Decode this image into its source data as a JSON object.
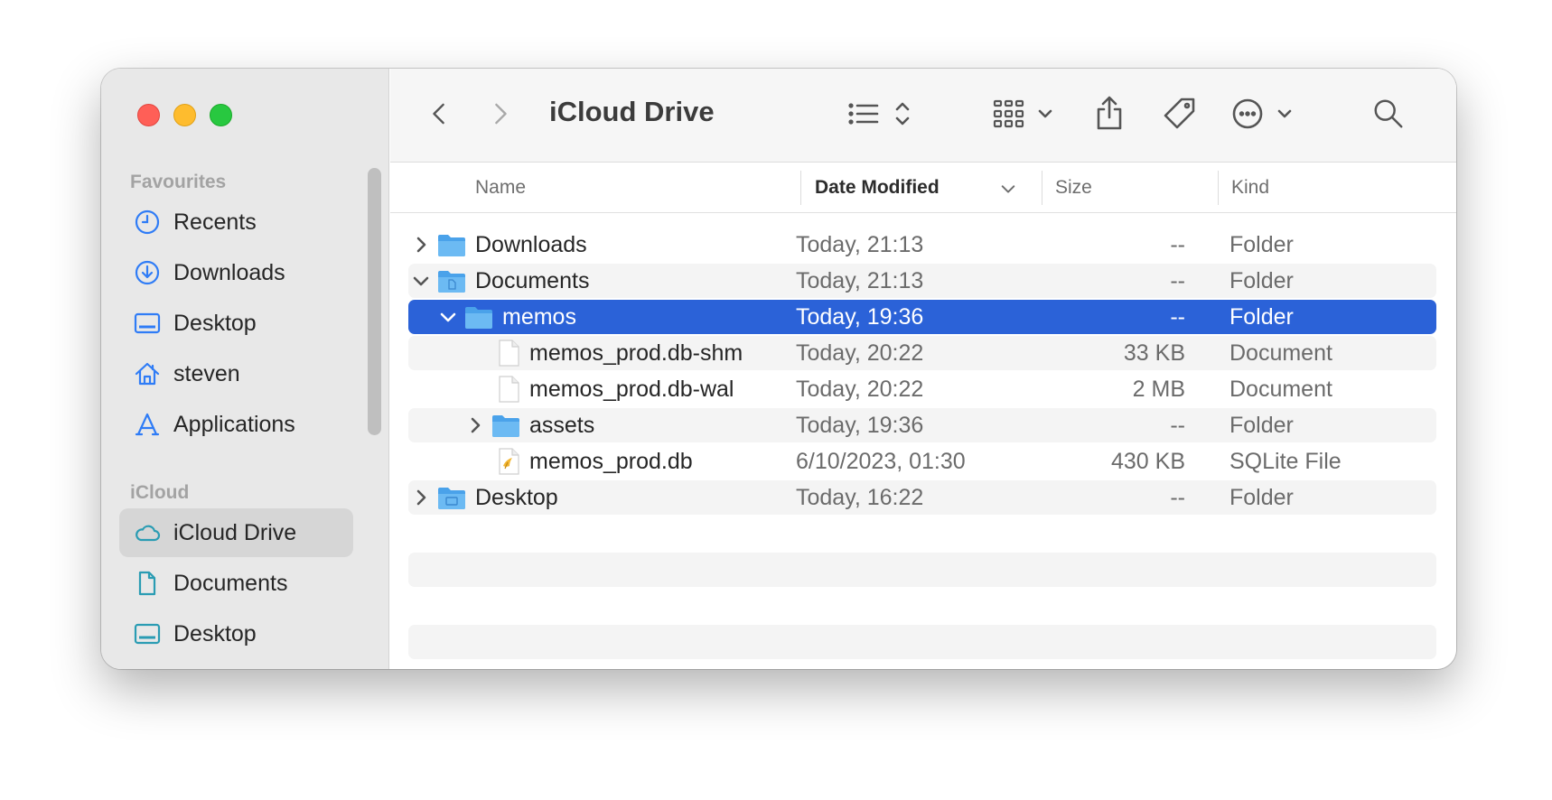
{
  "window": {
    "title": "iCloud Drive"
  },
  "sidebar": {
    "sections": [
      {
        "title": "Favourites",
        "items": [
          {
            "label": "Recents",
            "icon": "clock-icon"
          },
          {
            "label": "Downloads",
            "icon": "download-circle-icon"
          },
          {
            "label": "Desktop",
            "icon": "desktop-icon"
          },
          {
            "label": "steven",
            "icon": "home-icon"
          },
          {
            "label": "Applications",
            "icon": "applications-icon"
          }
        ]
      },
      {
        "title": "iCloud",
        "items": [
          {
            "label": "iCloud Drive",
            "icon": "cloud-icon",
            "active": true
          },
          {
            "label": "Documents",
            "icon": "document-icon"
          },
          {
            "label": "Desktop",
            "icon": "desktop-icon"
          }
        ]
      }
    ]
  },
  "table": {
    "columns": {
      "name": "Name",
      "date": "Date Modified",
      "size": "Size",
      "kind": "Kind"
    },
    "sort": {
      "column": "date",
      "direction": "descending"
    },
    "rows": [
      {
        "name": "Downloads",
        "date": "Today, 21:13",
        "size": "--",
        "kind": "Folder",
        "depth": 0,
        "disclosure": "collapsed",
        "icon": "folder-icon"
      },
      {
        "name": "Documents",
        "date": "Today, 21:13",
        "size": "--",
        "kind": "Folder",
        "depth": 0,
        "disclosure": "expanded",
        "icon": "documents-folder-icon"
      },
      {
        "name": "memos",
        "date": "Today, 19:36",
        "size": "--",
        "kind": "Folder",
        "depth": 1,
        "disclosure": "expanded",
        "icon": "folder-icon",
        "selected": true
      },
      {
        "name": "memos_prod.db-shm",
        "date": "Today, 20:22",
        "size": "33 KB",
        "kind": "Document",
        "depth": 2,
        "disclosure": "none",
        "icon": "file-icon"
      },
      {
        "name": "memos_prod.db-wal",
        "date": "Today, 20:22",
        "size": "2 MB",
        "kind": "Document",
        "depth": 2,
        "disclosure": "none",
        "icon": "file-icon"
      },
      {
        "name": "assets",
        "date": "Today, 19:36",
        "size": "--",
        "kind": "Folder",
        "depth": 2,
        "disclosure": "collapsed",
        "icon": "folder-icon"
      },
      {
        "name": "memos_prod.db",
        "date": "6/10/2023, 01:30",
        "size": "430 KB",
        "kind": "SQLite File",
        "depth": 2,
        "disclosure": "none",
        "icon": "sqlite-file-icon"
      },
      {
        "name": "Desktop",
        "date": "Today, 16:22",
        "size": "--",
        "kind": "Folder",
        "depth": 0,
        "disclosure": "collapsed",
        "icon": "desktop-folder-icon"
      }
    ]
  },
  "colors": {
    "accent": "#2b62d8",
    "sidebar_icon": "#2f7cf6",
    "icloud_icon": "#2a9cb3",
    "folder": "#5aaef0",
    "close": "#ff5f57",
    "minimize": "#febc2e",
    "zoom": "#28c840"
  }
}
